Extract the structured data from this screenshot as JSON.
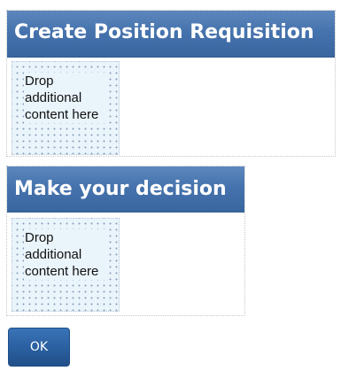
{
  "sections": [
    {
      "title": "Create Position Requisition",
      "drop_zone_text": "Drop additional content here"
    },
    {
      "title": "Make your decision",
      "drop_zone_text": "Drop additional content here"
    }
  ],
  "actions": {
    "ok_label": "OK"
  },
  "colors": {
    "header_blue": "#4673ad",
    "drop_zone_bg": "#eaf4fb",
    "button_blue": "#2a5f9f"
  }
}
